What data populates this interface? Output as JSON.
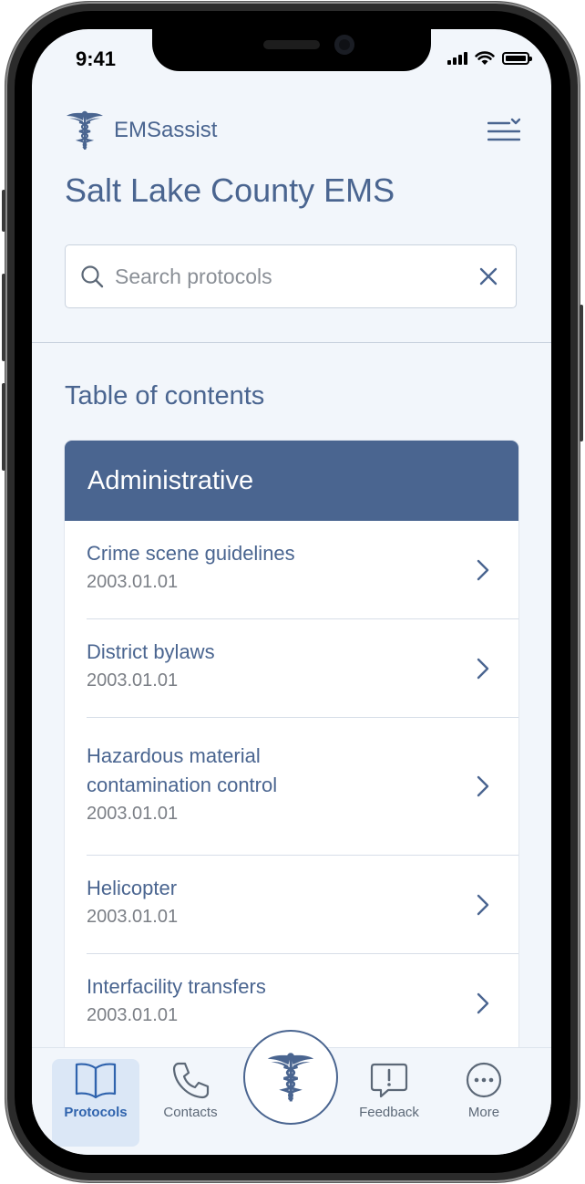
{
  "status": {
    "time": "9:41"
  },
  "app": {
    "name": "EMSassist"
  },
  "header": {
    "title": "Salt Lake County EMS"
  },
  "search": {
    "placeholder": "Search protocols",
    "value": ""
  },
  "toc": {
    "heading": "Table of contents",
    "section": "Administrative",
    "items": [
      {
        "title": "Crime scene guidelines",
        "code": "2003.01.01"
      },
      {
        "title": "District bylaws",
        "code": "2003.01.01"
      },
      {
        "title": "Hazardous material contamination control",
        "code": "2003.01.01"
      },
      {
        "title": "Helicopter",
        "code": "2003.01.01"
      },
      {
        "title": "Interfacility transfers",
        "code": "2003.01.01"
      }
    ]
  },
  "tabs": [
    {
      "label": "Protocols",
      "icon": "book-icon",
      "active": true
    },
    {
      "label": "Contacts",
      "icon": "phone-icon",
      "active": false
    },
    {
      "label": "",
      "icon": "caduceus-icon",
      "active": false
    },
    {
      "label": "Feedback",
      "icon": "feedback-icon",
      "active": false
    },
    {
      "label": "More",
      "icon": "more-icon",
      "active": false
    }
  ],
  "colors": {
    "primary": "#4a6590",
    "active_tab": "#2f63ad",
    "background": "#f2f6fb"
  }
}
